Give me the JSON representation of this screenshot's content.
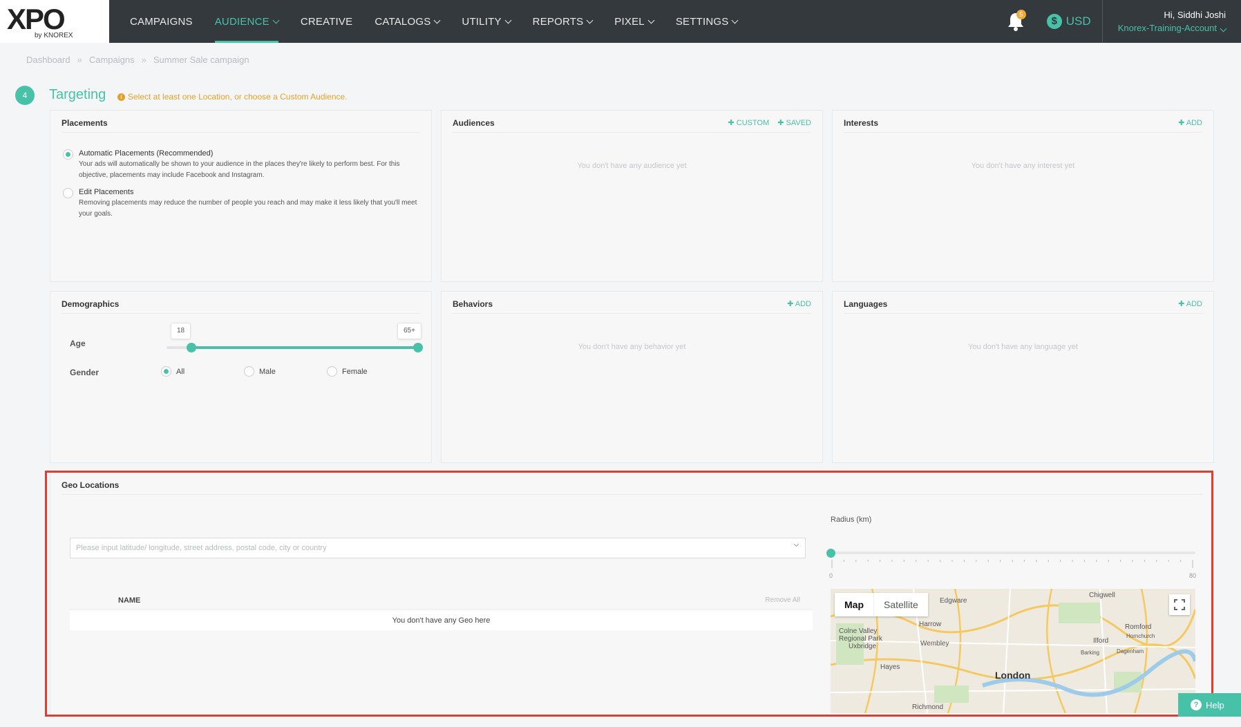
{
  "logo": {
    "brand": "XPO",
    "sub": "by KNOREX"
  },
  "nav": {
    "items": [
      {
        "label": "CAMPAIGNS",
        "dropdown": false
      },
      {
        "label": "AUDIENCE",
        "dropdown": true,
        "active": true
      },
      {
        "label": "CREATIVE",
        "dropdown": false
      },
      {
        "label": "CATALOGS",
        "dropdown": true
      },
      {
        "label": "UTILITY",
        "dropdown": true
      },
      {
        "label": "REPORTS",
        "dropdown": true
      },
      {
        "label": "PIXEL",
        "dropdown": true
      },
      {
        "label": "SETTINGS",
        "dropdown": true
      }
    ],
    "notification_count": "5",
    "currency": "USD",
    "currency_symbol": "$",
    "user_greeting": "Hi, Siddhi Joshi",
    "account": "Knorex-Training-Account"
  },
  "breadcrumb": {
    "items": [
      "Dashboard",
      "Campaigns",
      "Summer Sale campaign"
    ],
    "separator": "»"
  },
  "targeting": {
    "step": "4",
    "title": "Targeting",
    "warning_icon": "i",
    "warning": "Select at least one Location, or choose a Custom Audience."
  },
  "placements": {
    "title": "Placements",
    "options": [
      {
        "title": "Automatic Placements (Recommended)",
        "desc": "Your ads will automatically be shown to your audience in the places they're likely to perform best. For this objective, placements may include Facebook and Instagram.",
        "checked": true
      },
      {
        "title": "Edit Placements",
        "desc": "Removing placements may reduce the number of people you reach and may make it less likely that you'll meet your goals.",
        "checked": false
      }
    ]
  },
  "audiences": {
    "title": "Audiences",
    "action_custom": "CUSTOM",
    "action_saved": "SAVED",
    "empty": "You don't have any audience yet"
  },
  "interests": {
    "title": "Interests",
    "action": "ADD",
    "empty": "You don't have any interest yet"
  },
  "demographics": {
    "title": "Demographics",
    "age_label": "Age",
    "age_min": "18",
    "age_max": "65+",
    "gender_label": "Gender",
    "gender_options": [
      {
        "label": "All",
        "checked": true
      },
      {
        "label": "Male",
        "checked": false
      },
      {
        "label": "Female",
        "checked": false
      }
    ]
  },
  "behaviors": {
    "title": "Behaviors",
    "action": "ADD",
    "empty": "You don't have any behavior yet"
  },
  "languages": {
    "title": "Languages",
    "action": "ADD",
    "empty": "You don't have any language yet"
  },
  "geo": {
    "title": "Geo Locations",
    "placeholder": "Please input latitude/ longitude, street address, postal code, city or country",
    "radius_label": "Radius (km)",
    "radius_min": "0",
    "radius_max": "80",
    "radius_value": 0,
    "col_name": "NAME",
    "remove_all": "Remove All",
    "empty": "You don't have any Geo here"
  },
  "map": {
    "tab_map": "Map",
    "tab_satellite": "Satellite",
    "labels": [
      "Edgware",
      "Chigwell",
      "Harrow",
      "Colne Valley Regional Park",
      "Uxbridge",
      "Wembley",
      "Romford",
      "Hornchurch",
      "Ilford",
      "Barking",
      "Dagenham",
      "Hayes",
      "Richmond"
    ],
    "city": "London"
  },
  "help": {
    "label": "Help",
    "icon": "?"
  },
  "colors": {
    "accent": "#47c1a8",
    "nav_bg": "#34393d",
    "warning": "#e3a12c",
    "highlight": "#e23b34"
  }
}
